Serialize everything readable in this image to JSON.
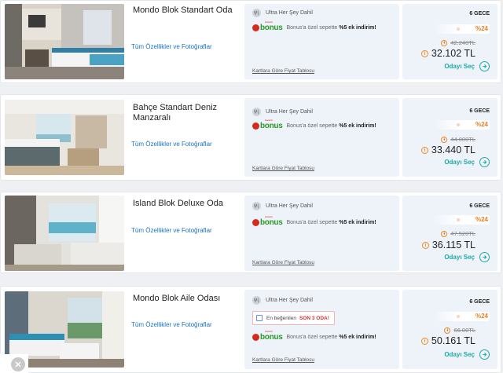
{
  "rooms": [
    {
      "title": "Mondo Blok Standart Oda",
      "features_link": "Tüm Özellikler ve Fotoğraflar",
      "board": "Ultra Her Şey Dahil",
      "bonus_prefix": "Bonus'a özel sepette",
      "bonus_highlight": "%5 ek indirim!",
      "price_table": "Kartlara Göre Fiyat Tablosu",
      "nights": "6 GECE",
      "discount": "%24",
      "old_price": "42.240TL",
      "new_price": "32.102 TL",
      "select": "Odayı Seç"
    },
    {
      "title": "Bahçe Standart Deniz Manzaralı",
      "features_link": "Tüm Özellikler ve Fotoğraflar",
      "board": "Ultra Her Şey Dahil",
      "bonus_prefix": "Bonus'a özel sepette",
      "bonus_highlight": "%5 ek indirim!",
      "price_table": "Kartlara Göre Fiyat Tablosu",
      "nights": "6 GECE",
      "discount": "%24",
      "old_price": "44.000TL",
      "new_price": "33.440 TL",
      "select": "Odayı Seç"
    },
    {
      "title": "Island Blok Deluxe Oda",
      "features_link": "Tüm Özellikler ve Fotoğraflar",
      "board": "Ultra Her Şey Dahil",
      "bonus_prefix": "Bonus'a özel sepette",
      "bonus_highlight": "%5 ek indirim!",
      "price_table": "Kartlara Göre Fiyat Tablosu",
      "nights": "6 GECE",
      "discount": "%24",
      "old_price": "47.520TL",
      "new_price": "36.115 TL",
      "select": "Odayı Seç"
    },
    {
      "title": "Mondo Blok Aile Odası",
      "features_link": "Tüm Özellikler ve Fotoğraflar",
      "board": "Ultra Her Şey Dahil",
      "popular_text": "En beğenilen",
      "popular_highlight": "SON 3 ODA!",
      "bonus_prefix": "Bonus'a özel sepette",
      "bonus_highlight": "%5 ek indirim!",
      "price_table": "Kartlara Göre Fiyat Tablosu",
      "nights": "6 GECE",
      "discount": "%24",
      "old_price": "66.00TL",
      "new_price": "50.161 TL",
      "select": "Odayı Seç"
    }
  ],
  "bonus_logo": {
    "word": "bonus",
    "tag": "Garanti"
  },
  "close_button": "✕",
  "colors": {
    "link": "#1a73c8",
    "accent_teal": "#1eaaa7",
    "discount_orange": "#f07c1d",
    "panel_bg": "#eef2f9"
  }
}
